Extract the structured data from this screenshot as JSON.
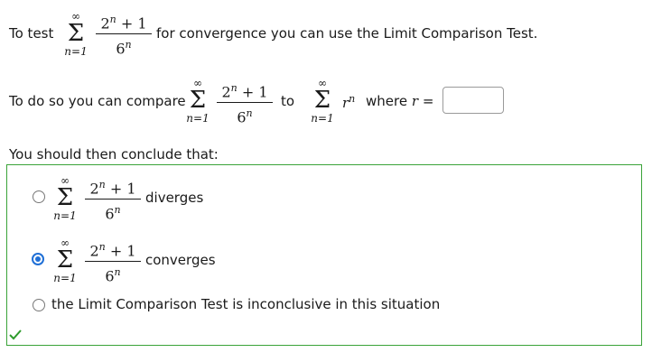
{
  "question": {
    "intro_prefix": "To test",
    "intro_suffix": "for convergence you can use the Limit Comparison Test.",
    "compare_prefix": "To do so you can compare",
    "compare_to": "to",
    "where_r": "where",
    "r_var": "r",
    "equals": "=",
    "r_input_value": "",
    "conclude_label": "You should then conclude that:"
  },
  "series": {
    "upper": "∞",
    "lower": "n=1",
    "numerator": "2",
    "numerator_exp": "n",
    "numerator_tail": " + 1",
    "denominator": "6",
    "denominator_exp": "n",
    "r_base": "r",
    "r_exp": "n"
  },
  "options": [
    {
      "label": "diverges",
      "selected": false
    },
    {
      "label": "converges",
      "selected": true
    },
    {
      "label": "the Limit Comparison Test is inconclusive in this situation",
      "selected": false
    }
  ],
  "feedback": {
    "icon": "checkmark-icon",
    "status": "correct",
    "color": "#2e9b2c"
  }
}
